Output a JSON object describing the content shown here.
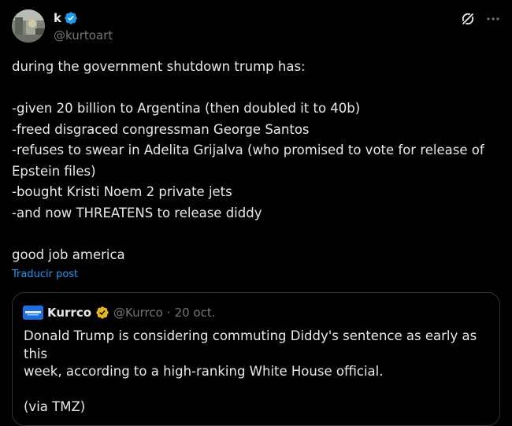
{
  "author": {
    "display_name": "k",
    "handle": "@kurtoart",
    "verified_color": "#1d9bf0"
  },
  "header": {
    "icons": [
      "grok-icon",
      "more-icon"
    ]
  },
  "tweet": {
    "lines": [
      "during the government shutdown trump has:",
      "",
      "-given 20 billion to Argentina (then doubled it to 40b)",
      "-freed disgraced congressman George Santos",
      "-refuses to swear in Adelita Grijalva (who promised to vote for release of",
      "Epstein files)",
      "-bought Kristi Noem 2 private jets",
      "-and now THREATENS to release diddy",
      "",
      "good job america"
    ]
  },
  "translate_label": "Traducir post",
  "quote": {
    "display_name": "Kurrco",
    "handle": "@Kurrco",
    "separator": "·",
    "date": "20 oct.",
    "verified_color": "#e2b719",
    "lines": [
      "Donald Trump is considering commuting Diddy's sentence as early as this",
      "week, according to a high-ranking White House official.",
      "",
      "(via TMZ)"
    ]
  },
  "colors": {
    "background": "#000000",
    "text": "#e7e9ea",
    "secondary": "#71767b",
    "link": "#1d9bf0",
    "border": "#2f3336"
  }
}
